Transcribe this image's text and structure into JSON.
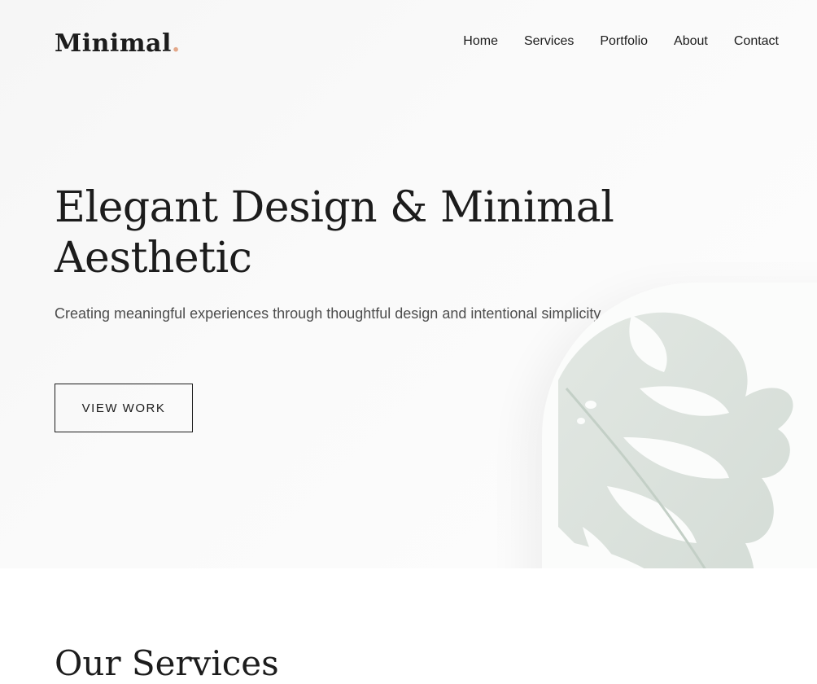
{
  "brand": {
    "name": "Minimal",
    "dot": ".",
    "dot_color": "#e3a88a"
  },
  "nav": {
    "items": [
      {
        "label": "Home"
      },
      {
        "label": "Services"
      },
      {
        "label": "Portfolio"
      },
      {
        "label": "About"
      },
      {
        "label": "Contact"
      }
    ]
  },
  "hero": {
    "title": "Elegant Design & Minimal Aesthetic",
    "subtitle": "Creating meaningful experiences through thoughtful design and intentional simplicity.",
    "cta_label": "VIEW WORK",
    "image_icon": "monstera-leaf-icon"
  },
  "services": {
    "title": "Our Services"
  },
  "colors": {
    "text": "#1c1c1c",
    "muted": "#4d4d4d",
    "accent": "#e3a88a"
  }
}
